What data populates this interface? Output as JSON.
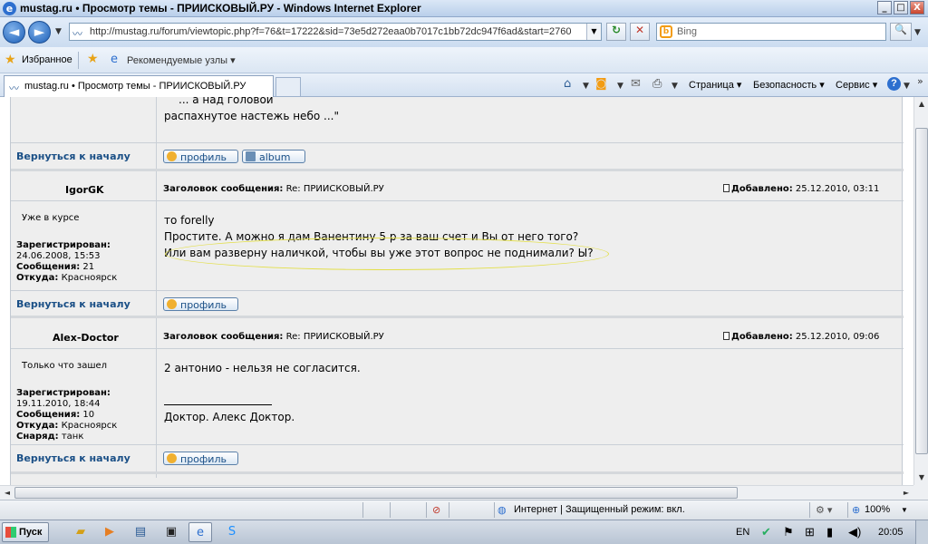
{
  "window": {
    "title": "mustag.ru • Просмотр темы - ПРИИСКОВЫЙ.РУ - Windows Internet Explorer",
    "min_label": "_",
    "max_label": "□",
    "close_label": "X"
  },
  "navbar": {
    "back_glyph": "◄",
    "forward_glyph": "►",
    "address": "http://mustag.ru/forum/viewtopic.php?f=76&t=17222&sid=73e5d272eaa0b7017c1bb72dc947f6ad&start=2760",
    "refresh_glyph": "↻",
    "stop_glyph": "✕",
    "search_placeholder": "Bing",
    "search_glyph": "🔍"
  },
  "favbar": {
    "favorites_label": "Избранное",
    "suggested_label": "Рекомендуемые узлы ▾"
  },
  "tab": {
    "label": "mustag.ru • Просмотр темы - ПРИИСКОВЫЙ.РУ"
  },
  "commands": {
    "page": "Страница ▾",
    "safety": "Безопасность ▾",
    "tools": "Сервис ▾",
    "help": "?"
  },
  "forum": {
    "prev_tail": {
      "line1": "... а над головой",
      "line2": "распахнутое настежь небо ...\""
    },
    "back_to_top": "Вернуться к началу",
    "profile_label": "профиль",
    "album_label": "album",
    "subject_label": "Заголовок сообщения:",
    "added_label": "Добавлено:",
    "posts": [
      {
        "author": "IgorGK",
        "rank": "Уже в курсе",
        "registered_label": "Зарегистрирован:",
        "registered": "24.06.2008, 15:53",
        "posts_label": "Сообщения:",
        "posts": "21",
        "from_label": "Откуда:",
        "from": "Красноярск",
        "subject": "Re: ПРИИСКОВЫЙ.РУ",
        "date": "25.12.2010, 03:11",
        "body": [
          "то forelly",
          "Простите. А можно я дам Ванентину 5 р за ваш счет и Вы от него того?",
          "Или вам разверну наличкой, чтобы вы уже этот вопрос не поднимали? Ы?"
        ]
      },
      {
        "author": "Alex-Doctor",
        "rank": "Только что зашел",
        "registered_label": "Зарегистрирован:",
        "registered": "19.11.2010, 18:44",
        "posts_label": "Сообщения:",
        "posts": "10",
        "from_label": "Откуда:",
        "from": "Красноярск",
        "gear_label": "Снаряд:",
        "gear": "танк",
        "subject": "Re: ПРИИСКОВЫЙ.РУ",
        "date": "25.12.2010, 09:06",
        "body": [
          "2 антонио - нельзя не согласится."
        ],
        "signature": "Доктор. Алекс Доктор."
      }
    ]
  },
  "statusbar": {
    "zone": "Интернет | Защищенный режим: вкл.",
    "zoom": "100%"
  },
  "taskbar": {
    "start_label": "Пуск",
    "language": "EN",
    "clock": "20:05"
  }
}
